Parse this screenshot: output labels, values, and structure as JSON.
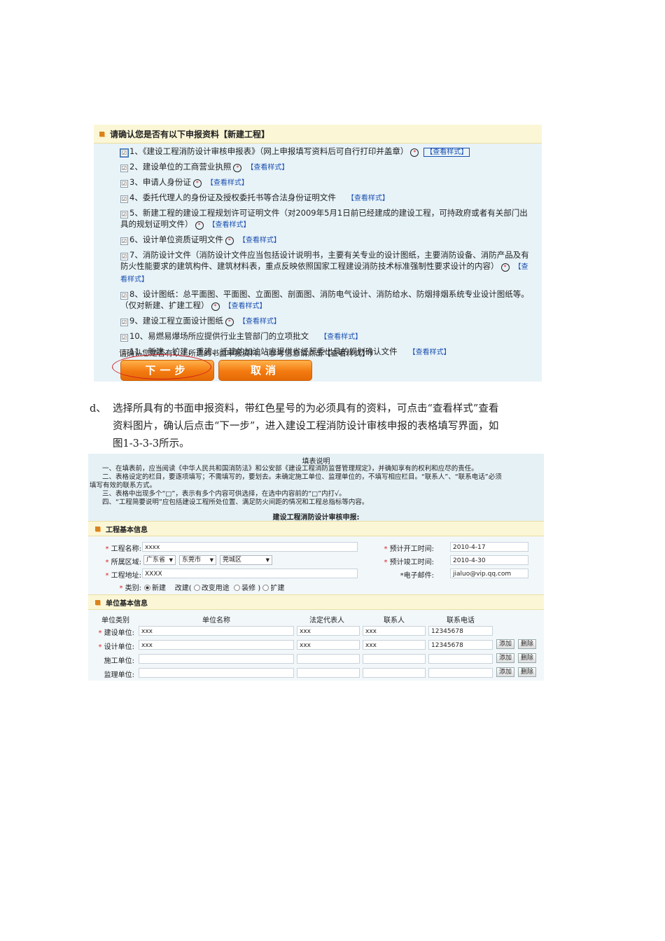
{
  "panel1": {
    "header": "请确认您是否有以下申报资料【新建工程】",
    "checkbox_mark": "☑",
    "star_mark": "*",
    "items": [
      {
        "text": "1、《建设工程消防设计审核申报表》（网上申报填写资料后可自行打印并盖章）",
        "link": "【查看样式】"
      },
      {
        "text": "2、建设单位的工商营业执照",
        "link": "【查看样式】"
      },
      {
        "text": "3、申请人身份证",
        "link": "【查看样式】"
      },
      {
        "text": "4、委托代理人的身份证及授权委托书等合法身份证明文件",
        "link": "【查看样式】"
      },
      {
        "text": "5、新建工程的建设工程规划许可证明文件（对2009年5月1日前已经建成的建设工程，可持政府或者有关部门出具的规划证明文件）",
        "link": "【查看样式】"
      },
      {
        "text": "6、设计单位资质证明文件",
        "link": "【查看样式】"
      },
      {
        "text": "7、消防设计文件（消防设计文件应当包括设计说明书，主要有关专业的设计图纸，主要消防设备、消防产品及有防火性能要求的建筑构件、建筑材料表，重点反映依照国家工程建设消防技术标准强制性要求设计的内容）",
        "link": "【查看样式】"
      },
      {
        "text": "8、设计图纸：总平面图、平面图、立面图、剖面图、消防电气设计、消防给水、防烟排烟系统专业设计图纸等。（仅对新建、扩建工程）",
        "link": "【查看样式】"
      },
      {
        "text": "9、建设工程立面设计图纸",
        "link": "【查看样式】"
      },
      {
        "text": "10、易燃易爆场所应提供行业主管部门的立项批文",
        "link": "【查看样式】"
      },
      {
        "text": "11、新建、扩建、重建、迁建的加油站应提供省经贸委出具的规划确认文件",
        "link": "【查看样式】"
      }
    ],
    "confirm_text": "请确认您是否有以上所选的书面申报资料。（参考信息请点击“【查看样式】”）",
    "next_button": "下一步",
    "cancel_button": "取消"
  },
  "paragraph": {
    "marker": "d、",
    "line1": "选择所具有的书面申报资料，带红色星号的为必须具有的资料，可点击“查看样式”查看",
    "line2": "资料图片，确认后点击“下一步”，进入建设工程消防设计审核申报的表格填写界面，如",
    "line3": "图1-3-3-3所示。"
  },
  "panel2": {
    "notes_title": "填表说明",
    "notes": [
      "一、在填表前，应当阅读《中华人民共和国消防法》和公安部《建设工程消防监督管理规定》，并确知享有的权利和应尽的责任。",
      "二、表格设定的栏目，要逐项填写；不需填写的，要划去。未确定施工单位、监理单位的，不填写相应栏目。“联系人”、“联系电话”必须",
      "填写有效的联系方式。",
      "三、表格中出现多个“□”，表示有多个内容可供选择，在选中内容前的“□”内打√。",
      "四、“工程简要说明”应包括建设工程所处位置、满足防火间距的情况和工程总指标等内容。"
    ],
    "form_title": "建设工程消防设计审核申报:",
    "section1": "工程基本信息",
    "required_mark": "*",
    "project_name_label": "工程名称:",
    "project_name_value": "xxxx",
    "region_label": "所属区域:",
    "province": "广东省",
    "city": "东莞市",
    "district": "莞城区",
    "address_label": "工程地址:",
    "address_value": "XXXX",
    "category_label": "类别:",
    "category_options": [
      "新建",
      "改建(",
      "改变用途",
      "装修",
      ")",
      "扩建"
    ],
    "start_label": "预计开工时间:",
    "start_value": "2010-4-17",
    "end_label": "预计竣工时间:",
    "end_value": "2010-4-30",
    "email_label": "*电子邮件:",
    "email_value": "jialuo@vip.qq.com",
    "section2": "单位基本信息",
    "unit_headers": [
      "单位类别",
      "单位名称",
      "法定代表人",
      "联系人",
      "联系电话"
    ],
    "units": [
      {
        "type": "建设单位:",
        "name": "xxx",
        "rep": "xxx",
        "contact": "xxx",
        "phone": "12345678"
      },
      {
        "type": "设计单位:",
        "name": "xxx",
        "rep": "xxx",
        "contact": "xxx",
        "phone": "12345678"
      },
      {
        "type": "施工单位:",
        "name": "",
        "rep": "",
        "contact": "",
        "phone": ""
      },
      {
        "type": "监理单位:",
        "name": "",
        "rep": "",
        "contact": "",
        "phone": ""
      }
    ],
    "add_button": "添加",
    "delete_button": "删除"
  }
}
